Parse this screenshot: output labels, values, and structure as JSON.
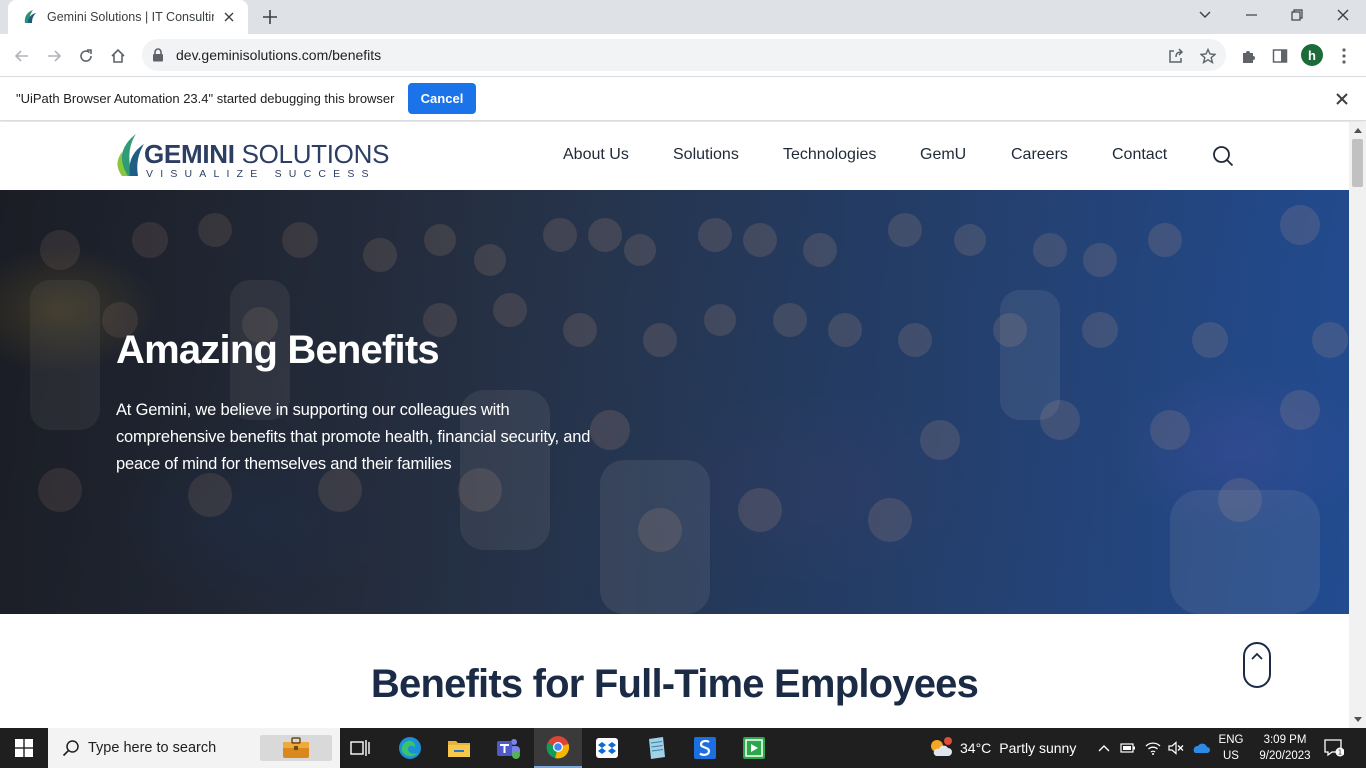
{
  "browser": {
    "tab_title": "Gemini Solutions | IT Consulting",
    "url": "dev.geminisolutions.com/benefits",
    "profile_initial": "h"
  },
  "infobar": {
    "message": "\"UiPath Browser Automation 23.4\" started debugging this browser",
    "cancel_label": "Cancel"
  },
  "site": {
    "logo": {
      "name_bold": "GEMINI",
      "name_light": " SOLUTIONS",
      "tagline": "VISUALIZE SUCCESS"
    },
    "nav": [
      {
        "label": "About Us"
      },
      {
        "label": "Solutions"
      },
      {
        "label": "Technologies"
      },
      {
        "label": "GemU"
      },
      {
        "label": "Careers"
      },
      {
        "label": "Contact"
      }
    ],
    "hero": {
      "title": "Amazing Benefits",
      "description": "At Gemini, we believe in supporting our colleagues with comprehensive benefits that promote health, financial security, and peace of mind for themselves and their families"
    },
    "section_title": "Benefits for Full-Time Employees",
    "brand_color": "#2c3e63",
    "accent_color": "#1a73e8"
  },
  "taskbar": {
    "search_placeholder": "Type here to search",
    "apps": [
      "task-view-icon",
      "edge-icon",
      "file-explorer-icon",
      "teams-icon",
      "chrome-icon",
      "dropbox-icon",
      "notepad-icon",
      "uipath-studio-icon",
      "uipath-assistant-icon"
    ],
    "weather": {
      "temp": "34°C",
      "condition": "Partly sunny"
    },
    "lang_top": "ENG",
    "lang_bottom": "US",
    "time": "3:09 PM",
    "date": "9/20/2023",
    "notifications_count": "1"
  }
}
